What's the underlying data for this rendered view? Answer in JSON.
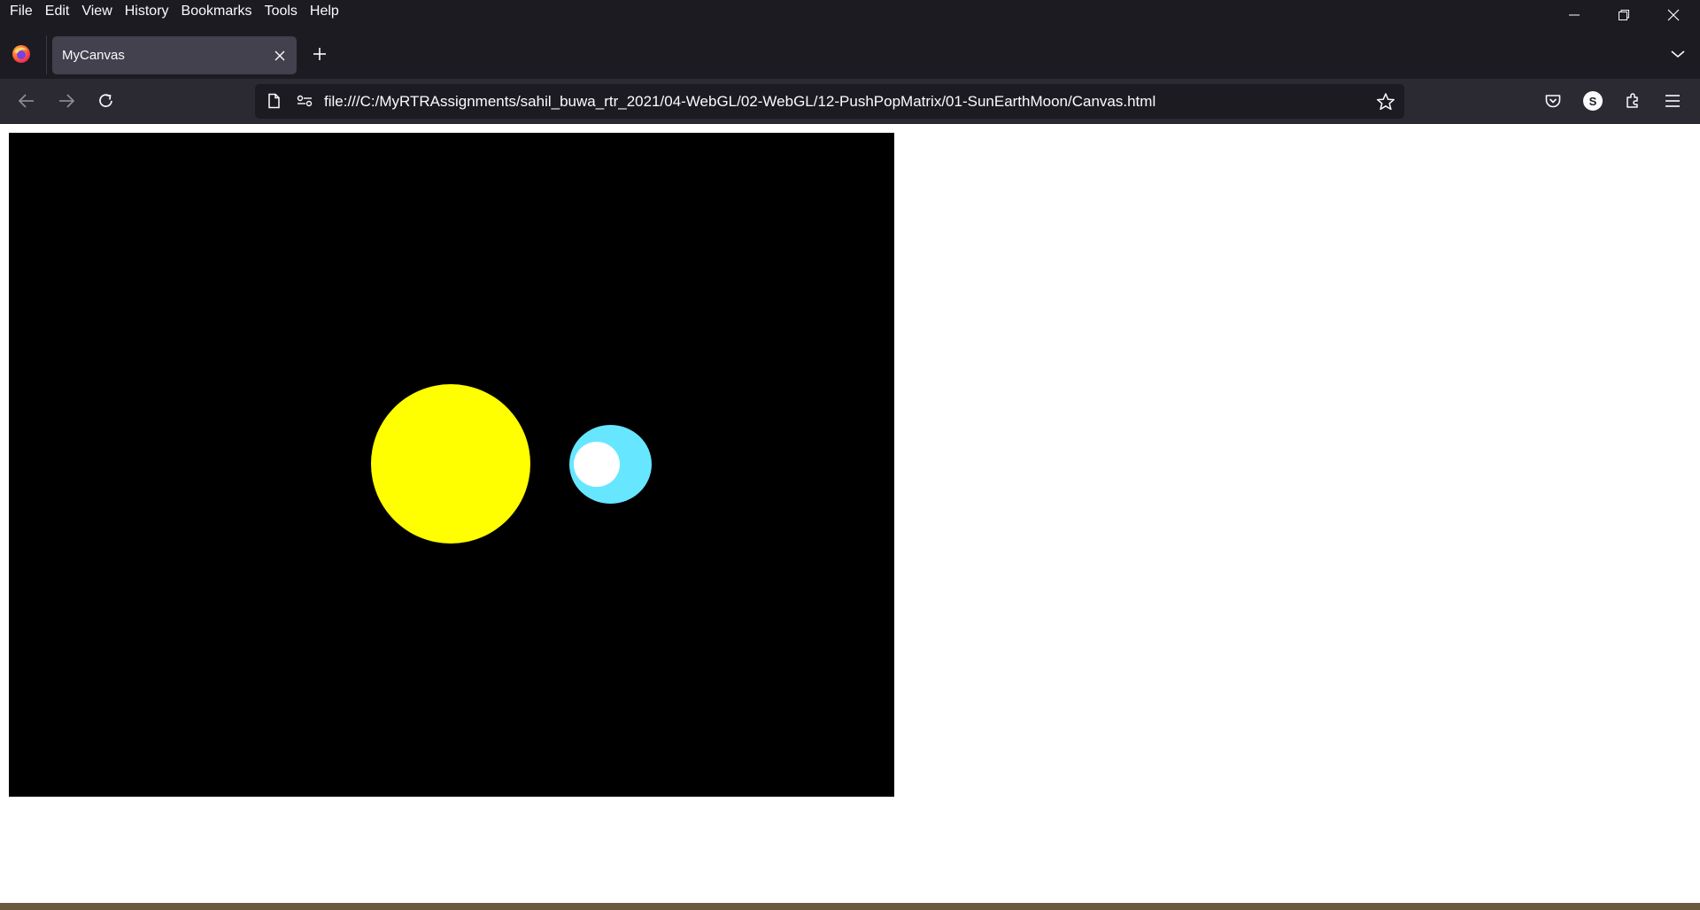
{
  "menubar": {
    "items": [
      "File",
      "Edit",
      "View",
      "History",
      "Bookmarks",
      "Tools",
      "Help"
    ]
  },
  "tab": {
    "title": "MyCanvas"
  },
  "navbar": {
    "url": "file:///C:/MyRTRAssignments/sahil_buwa_rtr_2021/04-WebGL/02-WebGL/12-PushPopMatrix/01-SunEarthMoon/Canvas.html",
    "account_initial": "S"
  },
  "icons": {
    "back": "back-arrow-icon",
    "forward": "forward-arrow-icon",
    "reload": "reload-icon",
    "page": "page-icon",
    "permissions": "permissions-icon",
    "bookmark": "star-icon",
    "pocket": "pocket-icon",
    "extensions": "puzzle-icon",
    "menu": "hamburger-icon"
  },
  "scene": {
    "background": "#000000",
    "sun_color": "#ffff00",
    "earth_color": "#66e6ff",
    "moon_color": "#ffffff"
  },
  "colors": {
    "chrome_bg": "#1c1b22",
    "toolbar_bg": "#2b2a33",
    "tab_bg": "#42414d",
    "text": "#fbfbfe"
  }
}
